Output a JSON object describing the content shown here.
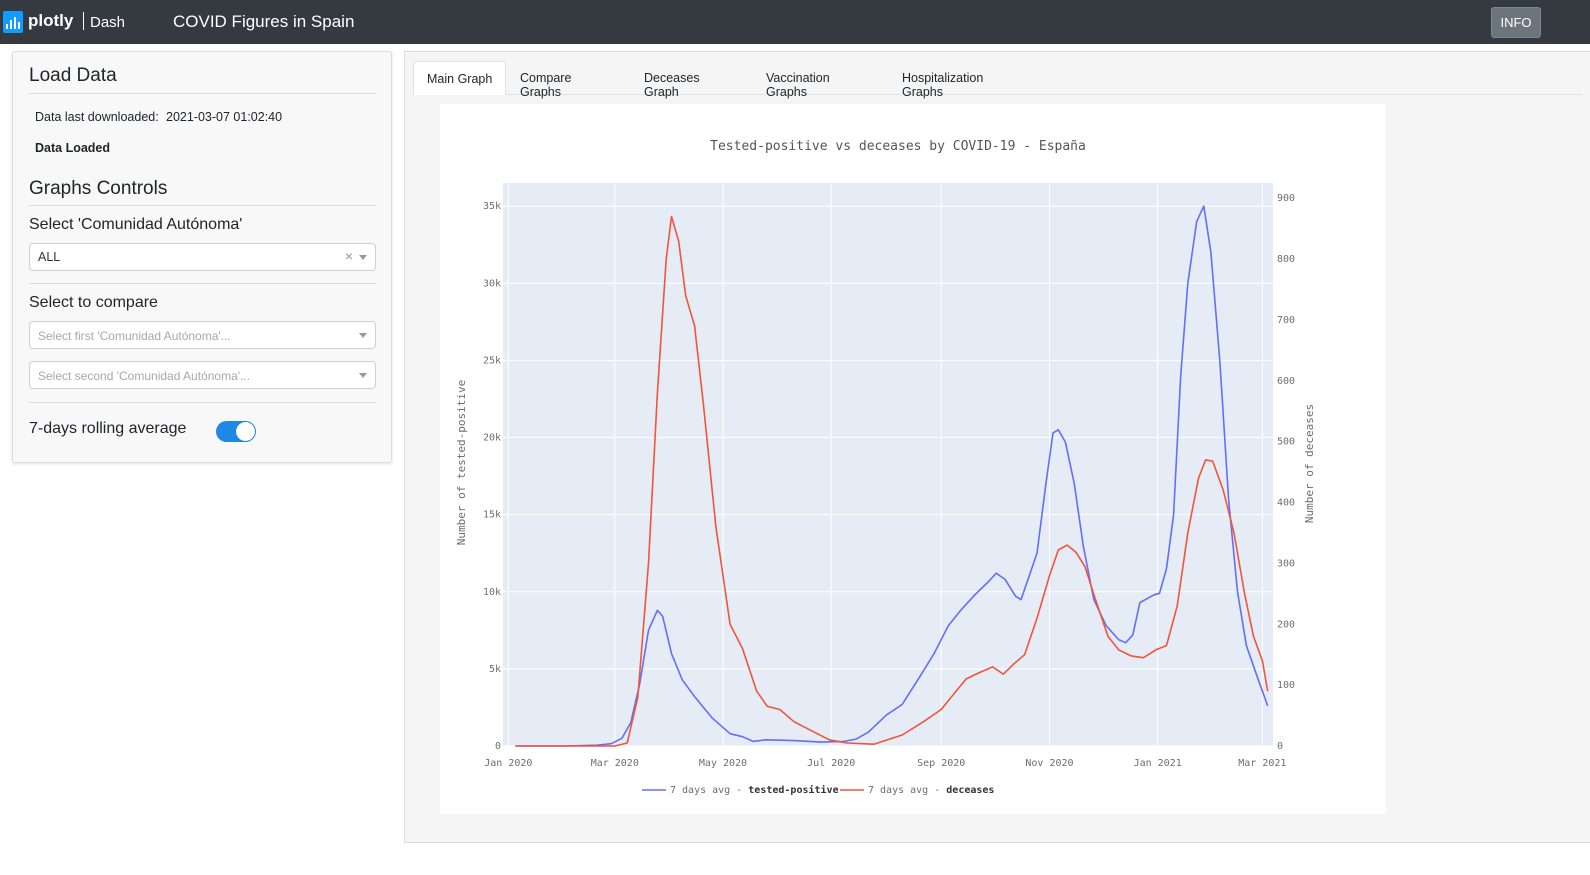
{
  "navbar": {
    "logo_text": "plotly",
    "logo_sub": "Dash",
    "title": "COVID Figures in Spain",
    "info_label": "INFO"
  },
  "sidebar": {
    "load_heading": "Load Data",
    "last_downloaded_label": "Data last downloaded:",
    "last_downloaded_value": "2021-03-07 01:02:40",
    "data_status": "Data Loaded",
    "controls_heading": "Graphs Controls",
    "ca_label": "Select 'Comunidad Autónoma'",
    "ca_value": "ALL",
    "clear_glyph": "×",
    "compare_label": "Select to compare",
    "compare_first_placeholder": "Select first 'Comunidad Autónoma'...",
    "compare_second_placeholder": "Select second 'Comunidad Autónoma'...",
    "rolling_label": "7-days rolling average",
    "rolling_enabled": true
  },
  "tabs": [
    {
      "label": "Main Graph",
      "active": true
    },
    {
      "label": "Compare Graphs",
      "active": false
    },
    {
      "label": "Deceases Graph",
      "active": false
    },
    {
      "label": "Vaccination Graphs",
      "active": false
    },
    {
      "label": "Hospitalization Graphs",
      "active": false
    }
  ],
  "chart_data": {
    "type": "line",
    "title": "Tested-positive vs deceases by COVID-19 - España",
    "ylabel": "Number of tested-positive",
    "y2label": "Number of deceases",
    "ylim": [
      0,
      36500
    ],
    "y2lim": [
      0,
      925
    ],
    "y_ticks": [
      0,
      5000,
      10000,
      15000,
      20000,
      25000,
      30000,
      35000
    ],
    "y_tick_labels": [
      "0",
      "5k",
      "10k",
      "15k",
      "20k",
      "25k",
      "30k",
      "35k"
    ],
    "y2_ticks": [
      0,
      100,
      200,
      300,
      400,
      500,
      600,
      700,
      800,
      900
    ],
    "y2_tick_labels": [
      "0",
      "100",
      "200",
      "300",
      "400",
      "500",
      "600",
      "700",
      "800",
      "900"
    ],
    "x_range": [
      "2019-12-29",
      "2021-03-07"
    ],
    "x_ticks": [
      "2020-01-01",
      "2020-03-01",
      "2020-05-01",
      "2020-07-01",
      "2020-09-01",
      "2020-11-01",
      "2021-01-01",
      "2021-03-01"
    ],
    "x_tick_labels": [
      "Jan 2020",
      "Mar 2020",
      "May 2020",
      "Jul 2020",
      "Sep 2020",
      "Nov 2020",
      "Jan 2021",
      "Mar 2021"
    ],
    "grid": true,
    "legend_position": "bottom",
    "colors": {
      "plot_bg": "#e5ecf6",
      "tested": "#636efa",
      "deceases": "#ef553b",
      "text": "#6e6e6e"
    },
    "series": [
      {
        "name_prefix": "7 days avg - ",
        "name_bold": "tested-positive",
        "axis": "y",
        "color": "#636efa",
        "points": [
          [
            "2020-01-05",
            0
          ],
          [
            "2020-02-01",
            0
          ],
          [
            "2020-02-20",
            50
          ],
          [
            "2020-02-28",
            150
          ],
          [
            "2020-03-05",
            500
          ],
          [
            "2020-03-10",
            1500
          ],
          [
            "2020-03-15",
            4000
          ],
          [
            "2020-03-20",
            7500
          ],
          [
            "2020-03-25",
            8800
          ],
          [
            "2020-03-28",
            8400
          ],
          [
            "2020-04-02",
            6000
          ],
          [
            "2020-04-08",
            4300
          ],
          [
            "2020-04-15",
            3200
          ],
          [
            "2020-04-25",
            1800
          ],
          [
            "2020-05-05",
            800
          ],
          [
            "2020-05-12",
            600
          ],
          [
            "2020-05-18",
            300
          ],
          [
            "2020-05-25",
            400
          ],
          [
            "2020-06-10",
            350
          ],
          [
            "2020-06-25",
            250
          ],
          [
            "2020-07-08",
            300
          ],
          [
            "2020-07-15",
            450
          ],
          [
            "2020-07-22",
            900
          ],
          [
            "2020-08-01",
            2000
          ],
          [
            "2020-08-10",
            2700
          ],
          [
            "2020-08-20",
            4500
          ],
          [
            "2020-08-28",
            6000
          ],
          [
            "2020-09-05",
            7800
          ],
          [
            "2020-09-12",
            8800
          ],
          [
            "2020-09-20",
            9800
          ],
          [
            "2020-09-28",
            10700
          ],
          [
            "2020-10-02",
            11200
          ],
          [
            "2020-10-07",
            10800
          ],
          [
            "2020-10-13",
            9700
          ],
          [
            "2020-10-16",
            9500
          ],
          [
            "2020-10-22",
            11500
          ],
          [
            "2020-10-25",
            12500
          ],
          [
            "2020-10-30",
            17000
          ],
          [
            "2020-11-03",
            20300
          ],
          [
            "2020-11-06",
            20500
          ],
          [
            "2020-11-10",
            19700
          ],
          [
            "2020-11-15",
            17000
          ],
          [
            "2020-11-20",
            13000
          ],
          [
            "2020-11-26",
            9500
          ],
          [
            "2020-12-03",
            7800
          ],
          [
            "2020-12-10",
            6900
          ],
          [
            "2020-12-14",
            6700
          ],
          [
            "2020-12-18",
            7200
          ],
          [
            "2020-12-22",
            9300
          ],
          [
            "2020-12-30",
            9800
          ],
          [
            "2021-01-02",
            9900
          ],
          [
            "2021-01-06",
            11500
          ],
          [
            "2021-01-10",
            15000
          ],
          [
            "2021-01-14",
            24000
          ],
          [
            "2021-01-18",
            30000
          ],
          [
            "2021-01-23",
            34000
          ],
          [
            "2021-01-27",
            35000
          ],
          [
            "2021-01-31",
            32000
          ],
          [
            "2021-02-05",
            25000
          ],
          [
            "2021-02-10",
            16000
          ],
          [
            "2021-02-15",
            10000
          ],
          [
            "2021-02-20",
            6500
          ],
          [
            "2021-02-27",
            4200
          ],
          [
            "2021-03-04",
            2600
          ]
        ]
      },
      {
        "name_prefix": "7 days avg - ",
        "name_bold": "deceases",
        "axis": "y2",
        "color": "#ef553b",
        "points": [
          [
            "2020-01-05",
            0
          ],
          [
            "2020-02-01",
            0
          ],
          [
            "2020-03-01",
            0
          ],
          [
            "2020-03-08",
            5
          ],
          [
            "2020-03-14",
            80
          ],
          [
            "2020-03-20",
            300
          ],
          [
            "2020-03-25",
            580
          ],
          [
            "2020-03-30",
            800
          ],
          [
            "2020-04-02",
            870
          ],
          [
            "2020-04-06",
            830
          ],
          [
            "2020-04-10",
            740
          ],
          [
            "2020-04-15",
            690
          ],
          [
            "2020-04-20",
            560
          ],
          [
            "2020-04-27",
            360
          ],
          [
            "2020-05-05",
            200
          ],
          [
            "2020-05-12",
            160
          ],
          [
            "2020-05-20",
            90
          ],
          [
            "2020-05-26",
            65
          ],
          [
            "2020-06-02",
            60
          ],
          [
            "2020-06-10",
            40
          ],
          [
            "2020-06-20",
            25
          ],
          [
            "2020-06-30",
            10
          ],
          [
            "2020-07-10",
            5
          ],
          [
            "2020-07-25",
            3
          ],
          [
            "2020-08-10",
            18
          ],
          [
            "2020-08-22",
            40
          ],
          [
            "2020-09-01",
            60
          ],
          [
            "2020-09-08",
            85
          ],
          [
            "2020-09-15",
            110
          ],
          [
            "2020-09-22",
            120
          ],
          [
            "2020-09-30",
            130
          ],
          [
            "2020-10-06",
            118
          ],
          [
            "2020-10-12",
            135
          ],
          [
            "2020-10-18",
            150
          ],
          [
            "2020-10-25",
            210
          ],
          [
            "2020-11-01",
            280
          ],
          [
            "2020-11-06",
            322
          ],
          [
            "2020-11-11",
            330
          ],
          [
            "2020-11-16",
            318
          ],
          [
            "2020-11-21",
            295
          ],
          [
            "2020-11-27",
            240
          ],
          [
            "2020-12-04",
            180
          ],
          [
            "2020-12-10",
            158
          ],
          [
            "2020-12-17",
            148
          ],
          [
            "2020-12-24",
            145
          ],
          [
            "2020-12-31",
            158
          ],
          [
            "2021-01-06",
            165
          ],
          [
            "2021-01-12",
            230
          ],
          [
            "2021-01-18",
            350
          ],
          [
            "2021-01-24",
            440
          ],
          [
            "2021-01-28",
            470
          ],
          [
            "2021-02-01",
            468
          ],
          [
            "2021-02-07",
            420
          ],
          [
            "2021-02-13",
            350
          ],
          [
            "2021-02-19",
            250
          ],
          [
            "2021-02-24",
            180
          ],
          [
            "2021-03-01",
            140
          ],
          [
            "2021-03-04",
            90
          ]
        ]
      }
    ]
  }
}
